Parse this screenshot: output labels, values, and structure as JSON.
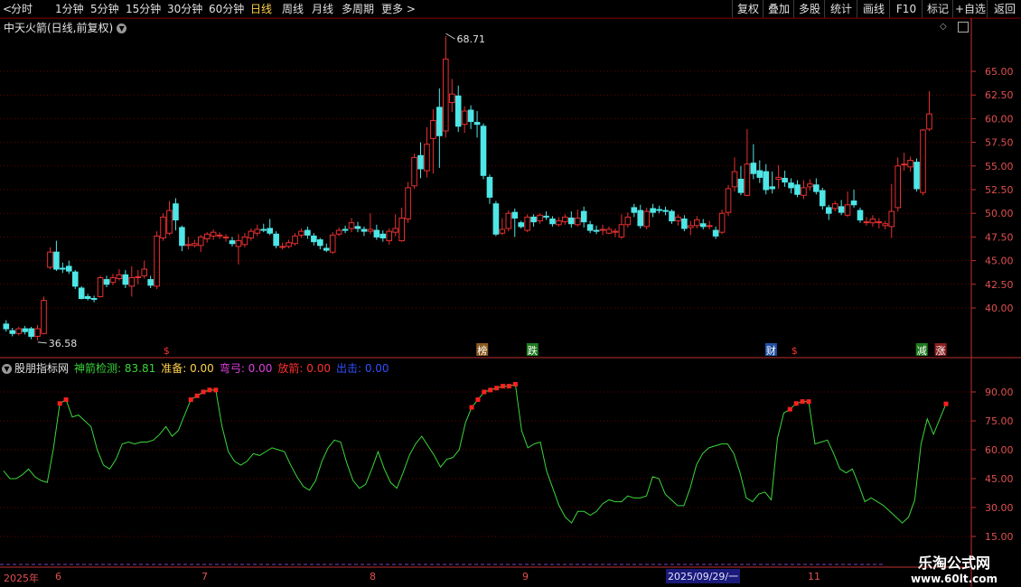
{
  "toolbar": {
    "periods": [
      "分时",
      "1分钟",
      "5分钟",
      "15分钟",
      "30分钟",
      "60分钟",
      "日线",
      "周线",
      "月线",
      "多周期",
      "更多 >"
    ],
    "active_period": "日线",
    "right_buttons": [
      "复权",
      "叠加",
      "多股",
      "统计",
      "画线",
      "F10",
      "标记",
      "+自选",
      "返回"
    ],
    "nav_left": "<",
    "nav_right": ">"
  },
  "stock": {
    "title": "中天火箭(日线,前复权)",
    "high_label": "68.71",
    "low_label": "36.58"
  },
  "price_axis": [
    "65.00",
    "62.50",
    "60.00",
    "57.50",
    "55.00",
    "52.50",
    "50.00",
    "47.50",
    "45.00",
    "42.50",
    "40.00"
  ],
  "indicator": {
    "name": "股朋指标网",
    "fields": [
      {
        "label": "神箭检测: 83.81",
        "color": "#3ad63a"
      },
      {
        "label": "准备: 0.00",
        "color": "#ffd24a"
      },
      {
        "label": "弯弓: 0.00",
        "color": "#e040e0"
      },
      {
        "label": "放箭: 0.00",
        "color": "#ff3030"
      },
      {
        "label": "出击: 0.00",
        "color": "#3050ff"
      }
    ],
    "axis": [
      "90.00",
      "75.00",
      "60.00",
      "45.00",
      "30.00",
      "15.00"
    ]
  },
  "markers": [
    {
      "text": "$",
      "bg": "none",
      "color": "#ff3030"
    },
    {
      "text": "榜",
      "bg": "#8a5a20",
      "color": "#fff"
    },
    {
      "text": "跌",
      "bg": "#1f7a1f",
      "color": "#fff"
    },
    {
      "text": "财",
      "bg": "#1f4fa0",
      "color": "#fff"
    },
    {
      "text": "$",
      "bg": "none",
      "color": "#ff3030"
    },
    {
      "text": "减",
      "bg": "#1f7a1f",
      "color": "#fff"
    },
    {
      "text": "涨",
      "bg": "#8a1f1f",
      "color": "#fff"
    }
  ],
  "dates": {
    "year": "2025年",
    "months": [
      "6",
      "7",
      "8",
      "9",
      "11"
    ],
    "cursor": "2025/09/29/一"
  },
  "watermark": {
    "name": "乐淘公式网",
    "site": "www.60lt.com"
  },
  "colors": {
    "up": "#e83030",
    "down": "#4ee6e6",
    "indicator_line": "#3ad63a",
    "grid": "#6a0000"
  }
}
